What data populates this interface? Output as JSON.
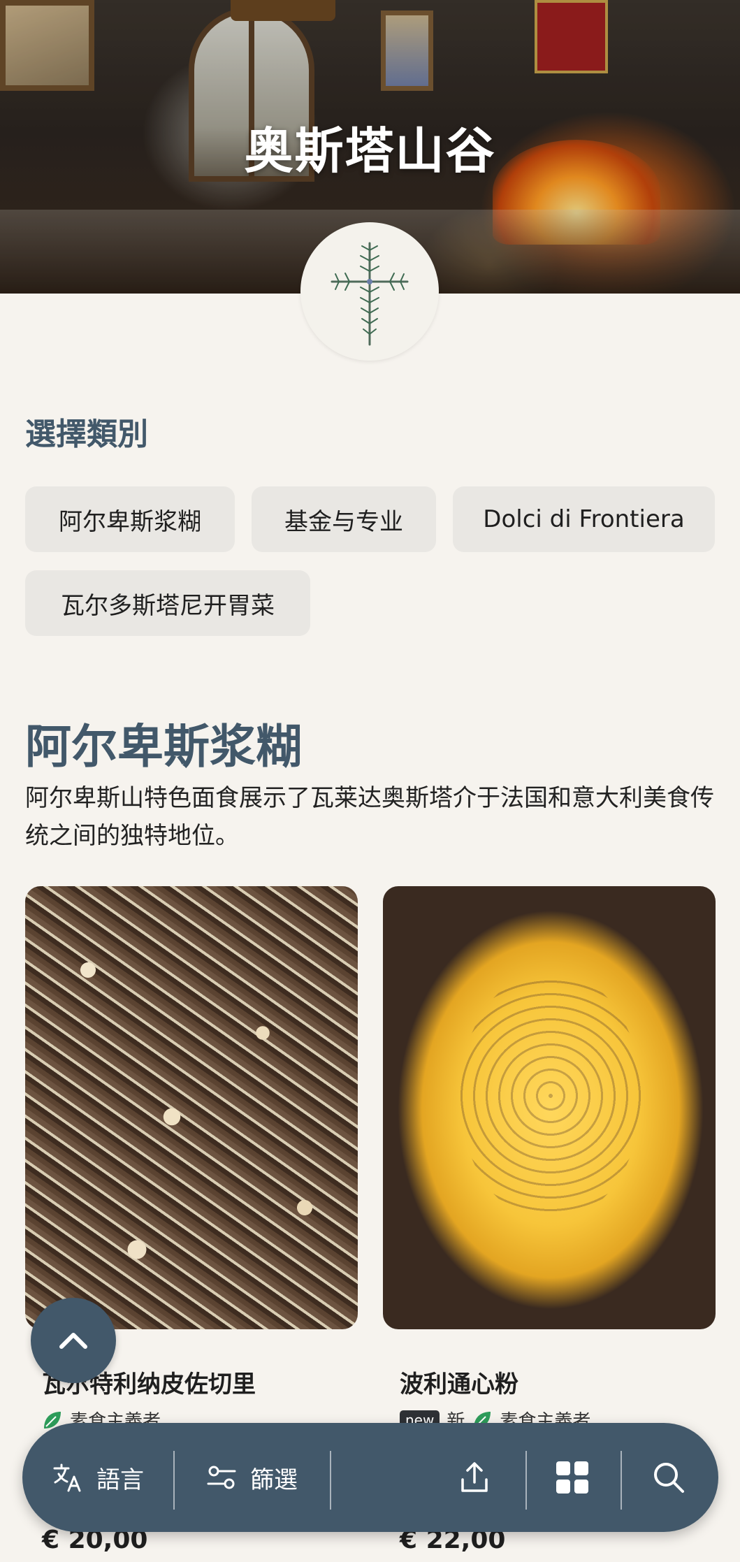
{
  "hero": {
    "title": "奥斯塔山谷"
  },
  "categories": {
    "heading": "選擇類別",
    "items": [
      "阿尔卑斯浆糊",
      "基金与专业",
      "Dolci di Frontiera",
      "瓦尔多斯塔尼开胃菜"
    ]
  },
  "section": {
    "title": "阿尔卑斯浆糊",
    "description": "阿尔卑斯山特色面食展示了瓦莱达奥斯塔介于法国和意大利美食传统之间的独特地位。"
  },
  "dishes": [
    {
      "name": "瓦尔特利纳皮佐切里",
      "tags": [
        "素食主義者"
      ],
      "price": "€ 20,00"
    },
    {
      "name": "波利通心粉",
      "badge": "new",
      "badge_label": "新",
      "tags": [
        "素食主義者"
      ],
      "price": "€ 22,00"
    }
  ],
  "toolbar": {
    "language_label": "語言",
    "filter_label": "篩選"
  },
  "icons": {
    "back_to_top": "chevron-up-icon",
    "language": "translate-icon",
    "filter": "sliders-icon",
    "share": "share-icon",
    "grid": "grid-icon",
    "search": "search-icon",
    "vegetarian": "leaf-icon",
    "logo": "rosemary-cross-icon"
  },
  "colors": {
    "accent": "#42586a",
    "background": "#f6f3ee",
    "chip": "#e9e7e3",
    "veg_green": "#2e9c5a"
  }
}
